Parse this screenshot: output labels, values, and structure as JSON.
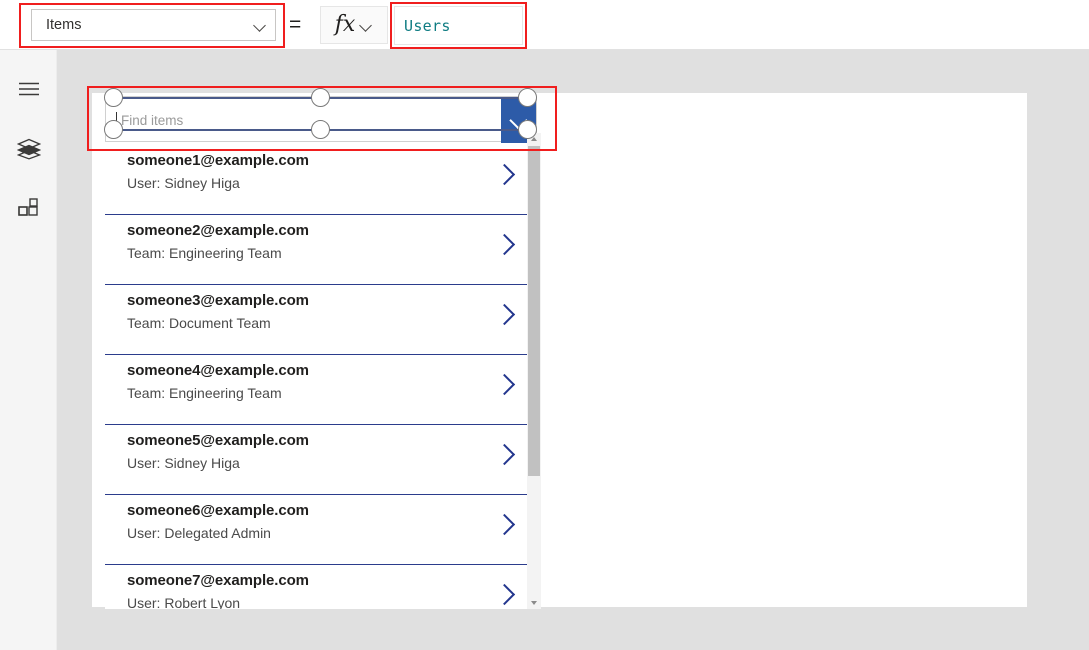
{
  "formula_bar": {
    "property_label": "Items",
    "property_dropdown_icon": "chevron-down-icon",
    "equals_sign": "=",
    "fx_label": "fx",
    "fx_dropdown_icon": "chevron-down-icon",
    "formula_value": "Users",
    "formula_color": "#0f7c82"
  },
  "sidebar": {
    "items": [
      {
        "name": "menu-icon",
        "label": "Menu"
      },
      {
        "name": "tree-view-icon",
        "label": "Tree view"
      },
      {
        "name": "insert-components-icon",
        "label": "Insert"
      }
    ]
  },
  "combo_box": {
    "placeholder": "Find items",
    "value": "",
    "dropdown_icon": "chevron-down-icon",
    "button_color": "#2d5ba8",
    "selected": true
  },
  "gallery": {
    "divider_color": "#2b3c8c",
    "chevron_icon": "chevron-right-icon",
    "items": [
      {
        "title": "someone1@example.com",
        "subtitle": "User: Sidney Higa"
      },
      {
        "title": "someone2@example.com",
        "subtitle": "Team: Engineering Team"
      },
      {
        "title": "someone3@example.com",
        "subtitle": "Team: Document Team"
      },
      {
        "title": "someone4@example.com",
        "subtitle": "Team: Engineering Team"
      },
      {
        "title": "someone5@example.com",
        "subtitle": "User: Sidney Higa"
      },
      {
        "title": "someone6@example.com",
        "subtitle": "User: Delegated Admin"
      },
      {
        "title": "someone7@example.com",
        "subtitle": "User: Robert Lyon"
      }
    ],
    "scrollbar": {
      "up_icon": "triangle-up-icon",
      "down_icon": "triangle-down-icon"
    }
  },
  "annotations": {
    "color": "#f01e1e",
    "boxes": [
      "property-selector",
      "formula-input",
      "combo-box-control"
    ]
  }
}
